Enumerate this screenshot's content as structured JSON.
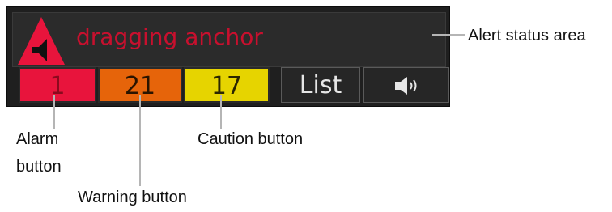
{
  "alert": {
    "message": "dragging anchor"
  },
  "buttons": {
    "alarm_count": "1",
    "warning_count": "21",
    "caution_count": "17",
    "list_label": "List",
    "sound_icon": "speaker-icon"
  },
  "callouts": {
    "status_area": "Alert status area",
    "alarm_line1": "Alarm",
    "alarm_line2": "button",
    "caution": "Caution button",
    "warning": "Warning button"
  },
  "colors": {
    "panel_bg": "#1f1f1f",
    "alarm": "#e8143c",
    "warning": "#e6640a",
    "caution": "#e6d400",
    "alert_text": "#c8102e",
    "callout_line": "#b5b5b5"
  }
}
